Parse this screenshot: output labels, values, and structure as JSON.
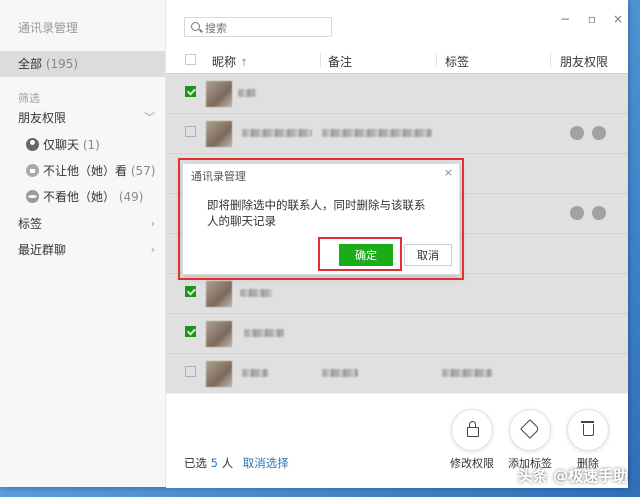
{
  "window": {
    "title": "通讯录管理",
    "controls": [
      "−",
      "▫",
      "×"
    ]
  },
  "sidebar": {
    "all_label": "全部",
    "all_count": "(195)",
    "filter_section": "筛选",
    "friend_perm": "朋友权限",
    "sub_items": [
      {
        "label": "仅聊天",
        "count": "(1)",
        "icon": "person-icon"
      },
      {
        "label": "不让他（她）看",
        "count": "(57)",
        "icon": "lock-icon"
      },
      {
        "label": "不看他（她）",
        "count": "(49)",
        "icon": "eye-hidden-icon"
      }
    ],
    "tags": "标签",
    "recent_groups": "最近群聊"
  },
  "search": {
    "placeholder": "搜索"
  },
  "table": {
    "columns": {
      "nickname": "昵称",
      "sort_arrow": "↑",
      "remark": "备注",
      "tag": "标签",
      "permission": "朋友权限"
    }
  },
  "dialog": {
    "title": "通讯录管理",
    "close": "×",
    "message": "即将删除选中的联系人，同时删除与该联系人的聊天记录",
    "ok": "确定",
    "cancel": "取消"
  },
  "footer": {
    "selected_prefix": "已选",
    "selected_count": "5",
    "selected_unit": "人",
    "cancel_select": "取消选择",
    "actions": [
      {
        "label": "修改权限",
        "icon": "lock-icon"
      },
      {
        "label": "添加标签",
        "icon": "tag-icon"
      },
      {
        "label": "删除",
        "icon": "trash-icon"
      }
    ]
  },
  "watermark": "头条 @极速手助"
}
